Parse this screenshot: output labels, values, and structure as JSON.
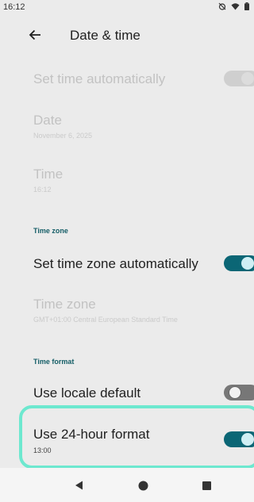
{
  "status_bar": {
    "time": "16:12",
    "icons": [
      "alarm-off-icon",
      "wifi-icon",
      "battery-icon"
    ]
  },
  "app_bar": {
    "back_icon": "arrow-left-icon",
    "title": "Date & time"
  },
  "settings": {
    "set_time_auto": {
      "title": "Set time automatically",
      "enabled": false,
      "checked": true
    },
    "date": {
      "title": "Date",
      "value": "November 6, 2025",
      "enabled": false
    },
    "time": {
      "title": "Time",
      "value": "16:12",
      "enabled": false
    },
    "time_zone_header": "Time zone",
    "set_tz_auto": {
      "title": "Set time zone automatically",
      "enabled": true,
      "checked": true
    },
    "time_zone": {
      "title": "Time zone",
      "value": "GMT+01:00 Central European Standard Time",
      "enabled": false
    },
    "time_format_header": "Time format",
    "use_locale_default": {
      "title": "Use locale default",
      "enabled": true,
      "checked": false
    },
    "use_24_hour": {
      "title": "Use 24-hour format",
      "value": "13:00",
      "enabled": true,
      "checked": true
    }
  },
  "nav_bar": {
    "buttons": [
      "back-triangle-icon",
      "home-circle-icon",
      "recents-square-icon"
    ]
  },
  "colors": {
    "accent": "#0b6675",
    "section_header": "#155e67",
    "highlight": "#6de8cf",
    "background": "#ebebeb"
  }
}
